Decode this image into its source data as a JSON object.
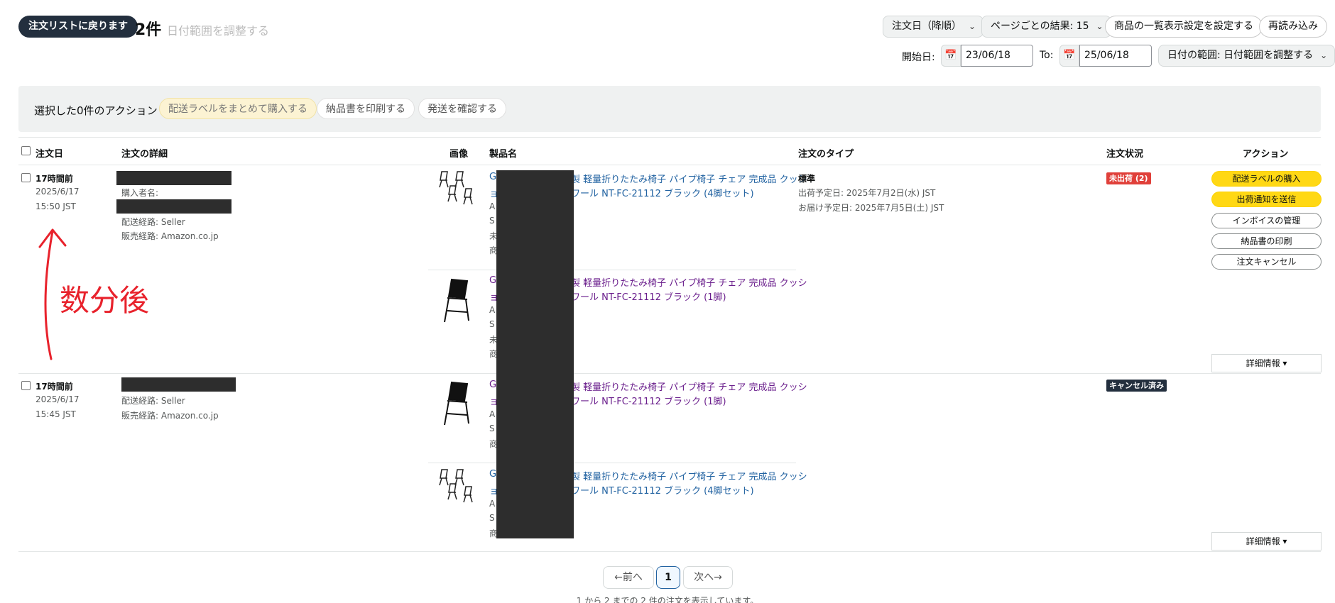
{
  "header": {
    "back_label": "注文リストに戻ります",
    "count": "2件",
    "date_hint": "日付範囲を調整する",
    "sort_select": "注文日（降順）",
    "per_page_select": "ページごとの結果: 15",
    "display_settings_button": "商品の一覧表示設定を設定する",
    "reload_button": "再読み込み",
    "start_label": "開始日:",
    "start_value": "23/06/18",
    "to_label": "To:",
    "end_value": "25/06/18",
    "range_select": "日付の範囲: 日付範囲を調整する"
  },
  "actions_bar": {
    "label": "選択した0件のアクション",
    "buy_labels": "配送ラベルをまとめて購入する",
    "print_slip": "納品書を印刷する",
    "confirm_ship": "発送を確認する"
  },
  "table": {
    "headers": {
      "date": "注文日",
      "details": "注文の詳細",
      "image": "画像",
      "product": "製品名",
      "type": "注文のタイプ",
      "status": "注文状況",
      "action": "アクション"
    }
  },
  "orders": [
    {
      "age": "17時間前",
      "date": "2025/6/17",
      "time": "15:50 JST",
      "buyer_label": "購入者名:",
      "route": "配送経路: Seller",
      "channel": "販売経路: Amazon.co.jp",
      "type": "標準",
      "ship_date": "出荷予定日: 2025年7月2日(水) JST",
      "delivery_date": "お届け予定日: 2025年7月5日(土) JST",
      "status": "未出荷 (2)",
      "status_color": "#e0403a",
      "items": [
        {
          "title_l1_prefix": "G",
          "title_l1": "製 軽量折りたたみ椅子 パイプ椅子 チェア 完成品 クッシ",
          "title_l2_prefix": "ョ",
          "title_l2": "ワール NT-FC-21112 ブラック (4脚セット)",
          "sub": [
            "A",
            "S",
            "未",
            "商"
          ]
        },
        {
          "title_l1_prefix": "G",
          "title_l1": "製 軽量折りたたみ椅子 パイプ椅子 チェア 完成品 クッシ",
          "title_l2_prefix": "ョ",
          "title_l2": "ワール NT-FC-21112 ブラック (1脚)",
          "sub": [
            "A",
            "S",
            "未",
            "商"
          ]
        }
      ],
      "actions": [
        "配送ラベルの購入",
        "出荷通知を送信",
        "インボイスの管理",
        "納品書の印刷",
        "注文キャンセル"
      ],
      "detail_button": "詳細情報 ▾"
    },
    {
      "age": "17時間前",
      "date": "2025/6/17",
      "time": "15:45 JST",
      "route": "配送経路: Seller",
      "channel": "販売経路: Amazon.co.jp",
      "status": "キャンセル済み",
      "status_color": "#232f3e",
      "items": [
        {
          "title_l1_prefix": "G",
          "title_l1": "製 軽量折りたたみ椅子 パイプ椅子 チェア 完成品 クッシ",
          "title_l2_prefix": "ョ",
          "title_l2": "ワール NT-FC-21112 ブラック (1脚)",
          "sub": [
            "A",
            "S",
            "商"
          ]
        },
        {
          "title_l1_prefix": "G",
          "title_l1": "製 軽量折りたたみ椅子 パイプ椅子 チェア 完成品 クッシ",
          "title_l2_prefix": "ョ",
          "title_l2": "ワール NT-FC-21112 ブラック (4脚セット)",
          "sub": [
            "A",
            "S",
            "商"
          ]
        }
      ],
      "detail_button": "詳細情報 ▾"
    }
  ],
  "annotation": {
    "text": "数分後"
  },
  "pagination": {
    "prev": "←前へ",
    "current": "1",
    "next": "次へ→",
    "summary": "1 から 2 までの 2 件の注文を表示しています。"
  }
}
